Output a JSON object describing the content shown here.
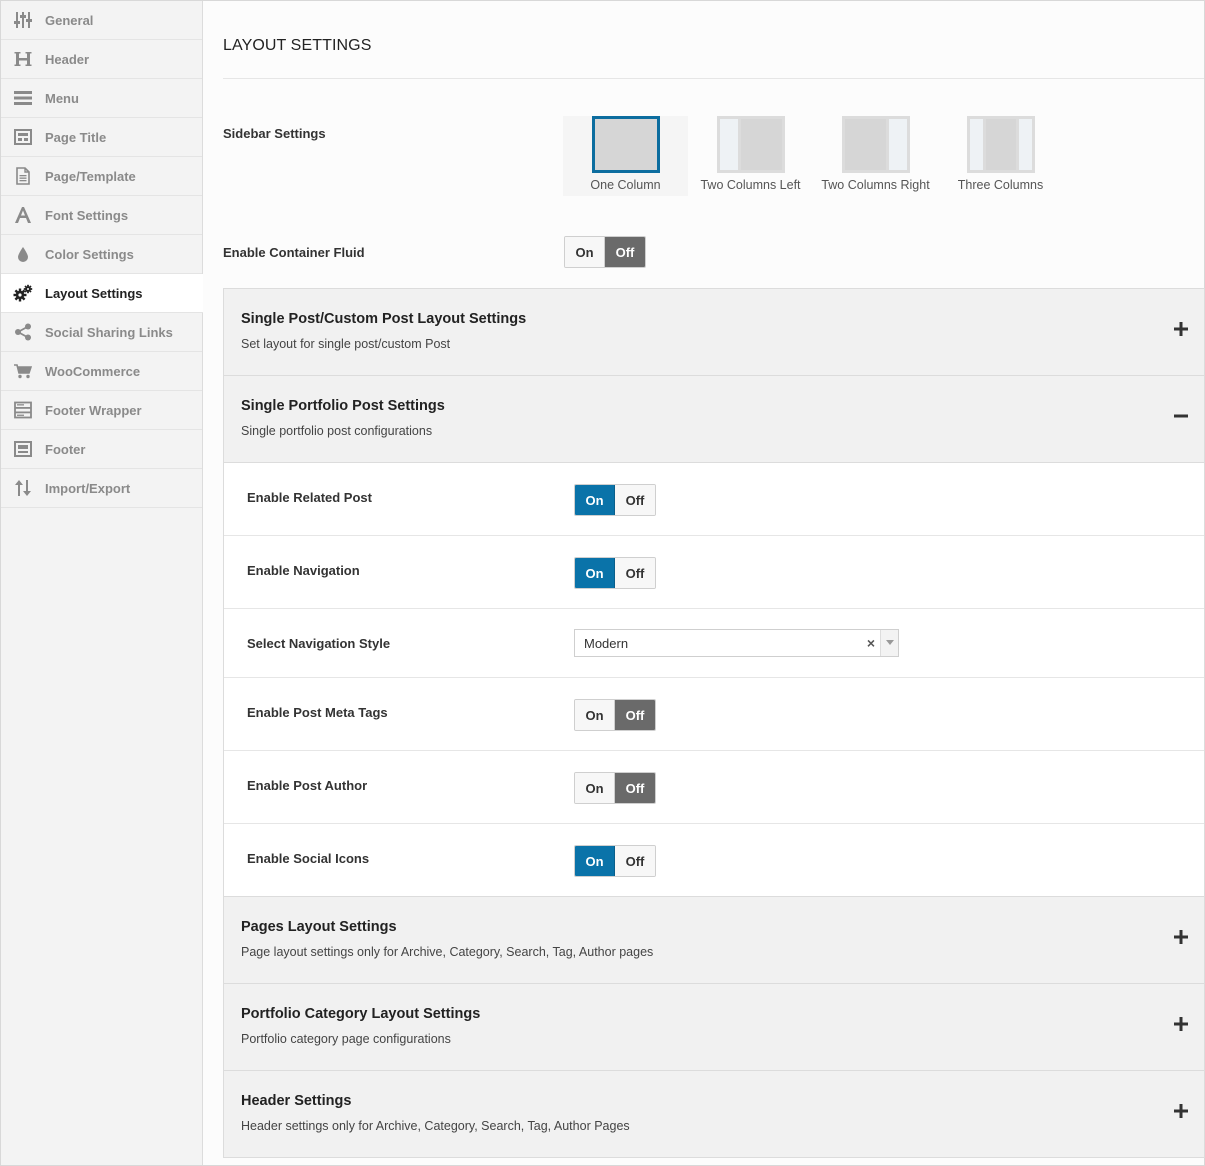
{
  "sidebar": {
    "items": [
      {
        "label": "General",
        "icon": "sliders-icon"
      },
      {
        "label": "Header",
        "icon": "header-h-icon"
      },
      {
        "label": "Menu",
        "icon": "menu-bars-icon"
      },
      {
        "label": "Page Title",
        "icon": "page-title-icon"
      },
      {
        "label": "Page/Template",
        "icon": "document-icon"
      },
      {
        "label": "Font Settings",
        "icon": "font-a-icon"
      },
      {
        "label": "Color Settings",
        "icon": "droplet-icon"
      },
      {
        "label": "Layout Settings",
        "icon": "gears-icon"
      },
      {
        "label": "Social Sharing Links",
        "icon": "share-icon"
      },
      {
        "label": "WooCommerce",
        "icon": "cart-icon"
      },
      {
        "label": "Footer Wrapper",
        "icon": "footer-wrapper-icon"
      },
      {
        "label": "Footer",
        "icon": "footer-icon"
      },
      {
        "label": "Import/Export",
        "icon": "import-export-icon"
      }
    ],
    "active_index": 7
  },
  "main": {
    "title": "LAYOUT SETTINGS",
    "sidebar_settings": {
      "label": "Sidebar Settings",
      "options": [
        "One Column",
        "Two Columns Left",
        "Two Columns Right",
        "Three Columns"
      ],
      "selected": "One Column"
    },
    "container_fluid": {
      "label": "Enable Container Fluid",
      "on_label": "On",
      "off_label": "Off",
      "state": "off"
    },
    "sections": [
      {
        "title": "Single Post/Custom Post Layout Settings",
        "subtitle": "Set layout for single post/custom Post",
        "expanded": false
      },
      {
        "title": "Single Portfolio Post Settings",
        "subtitle": "Single portfolio post configurations",
        "expanded": true,
        "rows": [
          {
            "label": "Enable Related Post",
            "type": "toggle",
            "state": "on"
          },
          {
            "label": "Enable Navigation",
            "type": "toggle",
            "state": "on"
          },
          {
            "label": "Select Navigation Style",
            "type": "select",
            "value": "Modern"
          },
          {
            "label": "Enable Post Meta Tags",
            "type": "toggle",
            "state": "off"
          },
          {
            "label": "Enable Post Author",
            "type": "toggle",
            "state": "off"
          },
          {
            "label": "Enable Social Icons",
            "type": "toggle",
            "state": "on"
          }
        ]
      },
      {
        "title": "Pages Layout Settings",
        "subtitle": "Page layout settings only for Archive, Category, Search, Tag, Author pages",
        "expanded": false
      },
      {
        "title": "Portfolio Category Layout Settings",
        "subtitle": "Portfolio category page configurations",
        "expanded": false
      },
      {
        "title": "Header Settings",
        "subtitle": "Header settings only for Archive, Category, Search, Tag, Author Pages",
        "expanded": false
      }
    ],
    "toggle_labels": {
      "on": "On",
      "off": "Off"
    },
    "select_clear": "×"
  },
  "colors": {
    "accent": "#0a73a9",
    "off_active": "#6a6a6a",
    "selected_border": "#0c6d9f"
  }
}
